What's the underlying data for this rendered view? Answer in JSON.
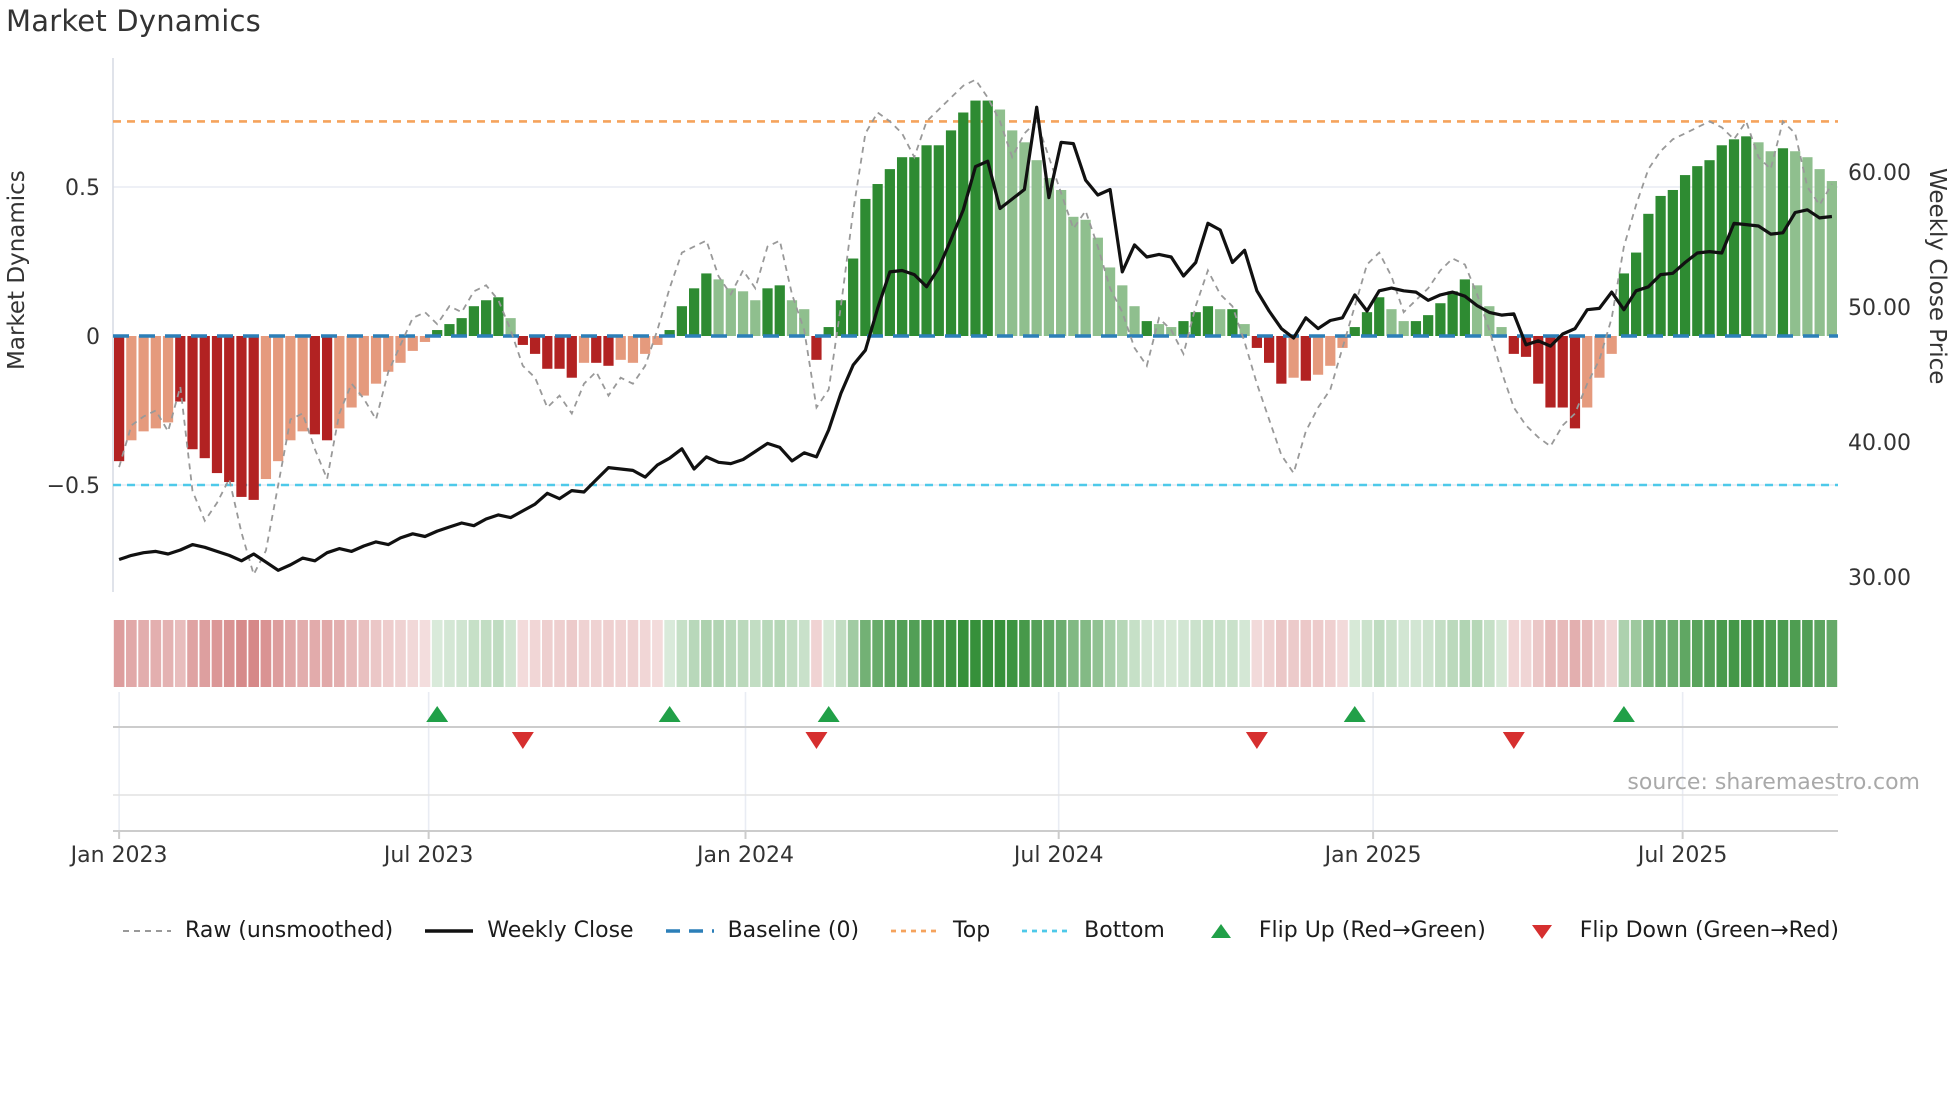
{
  "title": "Market Dynamics",
  "source_note": "source: sharemaestro.com",
  "colors": {
    "bar_dark_red": "#b22222",
    "bar_light_red": "#e59a7d",
    "bar_dark_green": "#2e8b32",
    "bar_light_green": "#8fbf8e",
    "baseline": "#2c7fb8",
    "top_line": "#f5a35c",
    "bottom_line": "#4ec9e9",
    "raw_line": "#999999",
    "price_line": "#111111",
    "flip_up": "#21a048",
    "flip_down": "#d62f2f",
    "grid": "#e9ecf3",
    "spine": "#d8dce4",
    "panel_line": "#cccccc",
    "tick_text": "#333333",
    "source_text": "#a9a9a9"
  },
  "axes": {
    "left": {
      "label": "Market Dynamics",
      "ticks": [
        {
          "v": 0.5,
          "label": "0.5"
        },
        {
          "v": 0,
          "label": "0"
        },
        {
          "v": -0.5,
          "label": "−0.5"
        }
      ]
    },
    "right": {
      "label": "Weekly Close Price",
      "ticks": [
        {
          "v": 60,
          "label": "60.00"
        },
        {
          "v": 50,
          "label": "50.00"
        },
        {
          "v": 40,
          "label": "40.00"
        },
        {
          "v": 30,
          "label": "30.00"
        }
      ]
    },
    "x": {
      "ticks": [
        {
          "i": 0,
          "label": "Jan 2023"
        },
        {
          "i": 25.3,
          "label": "Jul 2023"
        },
        {
          "i": 51.2,
          "label": "Jan 2024"
        },
        {
          "i": 76.8,
          "label": "Jul 2024"
        },
        {
          "i": 102.5,
          "label": "Jan 2025"
        },
        {
          "i": 127.8,
          "label": "Jul 2025"
        }
      ]
    }
  },
  "legend": [
    {
      "type": "dash-gray",
      "label": "Raw (unsmoothed)"
    },
    {
      "type": "solid-black",
      "label": "Weekly Close"
    },
    {
      "type": "dash-blue",
      "label": "Baseline (0)"
    },
    {
      "type": "dot-orange",
      "label": "Top"
    },
    {
      "type": "dot-cyan",
      "label": "Bottom"
    },
    {
      "type": "tri-up",
      "label": "Flip Up (Red→Green)"
    },
    {
      "type": "tri-down",
      "label": "Flip Down (Green→Red)"
    }
  ],
  "chart_data": {
    "type": "bar",
    "subtype": "composite-oscillator-with-price",
    "title": "Market Dynamics",
    "xlabel": "",
    "ylabel_left": "Market Dynamics",
    "ylabel_right": "Weekly Close Price",
    "x_range_labels": [
      "Jan 2023",
      "Jul 2023",
      "Jan 2024",
      "Jul 2024",
      "Jan 2025",
      "Jul 2025"
    ],
    "ylim_left": [
      -0.85,
      0.93
    ],
    "ylim_right_ticks": [
      30,
      40,
      50,
      60
    ],
    "reference_lines": {
      "baseline": 0,
      "top": 0.72,
      "bottom": -0.5
    },
    "legend_position": "bottom",
    "grid": "horizontal-faint",
    "bars_note": "weekly oscillator bars; shade d=saturated, l=muted; sign sets red/green",
    "bars": [
      [
        -0.42,
        "d"
      ],
      [
        -0.35,
        "l"
      ],
      [
        -0.32,
        "l"
      ],
      [
        -0.31,
        "l"
      ],
      [
        -0.29,
        "l"
      ],
      [
        -0.22,
        "d"
      ],
      [
        -0.38,
        "d"
      ],
      [
        -0.41,
        "d"
      ],
      [
        -0.46,
        "d"
      ],
      [
        -0.49,
        "d"
      ],
      [
        -0.54,
        "d"
      ],
      [
        -0.55,
        "d"
      ],
      [
        -0.48,
        "l"
      ],
      [
        -0.42,
        "l"
      ],
      [
        -0.35,
        "l"
      ],
      [
        -0.32,
        "l"
      ],
      [
        -0.33,
        "d"
      ],
      [
        -0.35,
        "d"
      ],
      [
        -0.31,
        "l"
      ],
      [
        -0.24,
        "l"
      ],
      [
        -0.2,
        "l"
      ],
      [
        -0.16,
        "l"
      ],
      [
        -0.12,
        "l"
      ],
      [
        -0.09,
        "l"
      ],
      [
        -0.05,
        "l"
      ],
      [
        -0.02,
        "l"
      ],
      [
        0.02,
        "d"
      ],
      [
        0.04,
        "d"
      ],
      [
        0.06,
        "d"
      ],
      [
        0.1,
        "d"
      ],
      [
        0.12,
        "d"
      ],
      [
        0.13,
        "d"
      ],
      [
        0.06,
        "l"
      ],
      [
        -0.03,
        "d"
      ],
      [
        -0.06,
        "d"
      ],
      [
        -0.11,
        "d"
      ],
      [
        -0.11,
        "d"
      ],
      [
        -0.14,
        "d"
      ],
      [
        -0.09,
        "l"
      ],
      [
        -0.09,
        "d"
      ],
      [
        -0.1,
        "d"
      ],
      [
        -0.08,
        "l"
      ],
      [
        -0.09,
        "l"
      ],
      [
        -0.06,
        "l"
      ],
      [
        -0.03,
        "l"
      ],
      [
        0.02,
        "d"
      ],
      [
        0.1,
        "d"
      ],
      [
        0.16,
        "d"
      ],
      [
        0.21,
        "d"
      ],
      [
        0.19,
        "l"
      ],
      [
        0.16,
        "l"
      ],
      [
        0.15,
        "l"
      ],
      [
        0.12,
        "l"
      ],
      [
        0.16,
        "d"
      ],
      [
        0.17,
        "d"
      ],
      [
        0.12,
        "l"
      ],
      [
        0.09,
        "l"
      ],
      [
        -0.08,
        "d"
      ],
      [
        0.03,
        "d"
      ],
      [
        0.12,
        "d"
      ],
      [
        0.26,
        "d"
      ],
      [
        0.46,
        "d"
      ],
      [
        0.51,
        "d"
      ],
      [
        0.56,
        "d"
      ],
      [
        0.6,
        "d"
      ],
      [
        0.6,
        "d"
      ],
      [
        0.64,
        "d"
      ],
      [
        0.64,
        "d"
      ],
      [
        0.69,
        "d"
      ],
      [
        0.75,
        "d"
      ],
      [
        0.79,
        "d"
      ],
      [
        0.79,
        "d"
      ],
      [
        0.76,
        "l"
      ],
      [
        0.69,
        "l"
      ],
      [
        0.65,
        "l"
      ],
      [
        0.59,
        "l"
      ],
      [
        0.53,
        "l"
      ],
      [
        0.49,
        "l"
      ],
      [
        0.4,
        "l"
      ],
      [
        0.39,
        "l"
      ],
      [
        0.33,
        "l"
      ],
      [
        0.23,
        "l"
      ],
      [
        0.17,
        "l"
      ],
      [
        0.1,
        "l"
      ],
      [
        0.05,
        "d"
      ],
      [
        0.04,
        "l"
      ],
      [
        0.03,
        "l"
      ],
      [
        0.05,
        "d"
      ],
      [
        0.08,
        "d"
      ],
      [
        0.1,
        "d"
      ],
      [
        0.09,
        "l"
      ],
      [
        0.09,
        "d"
      ],
      [
        0.04,
        "l"
      ],
      [
        -0.04,
        "d"
      ],
      [
        -0.09,
        "d"
      ],
      [
        -0.16,
        "d"
      ],
      [
        -0.14,
        "l"
      ],
      [
        -0.15,
        "d"
      ],
      [
        -0.13,
        "l"
      ],
      [
        -0.1,
        "l"
      ],
      [
        -0.04,
        "l"
      ],
      [
        0.03,
        "d"
      ],
      [
        0.08,
        "d"
      ],
      [
        0.13,
        "d"
      ],
      [
        0.09,
        "l"
      ],
      [
        0.05,
        "l"
      ],
      [
        0.05,
        "d"
      ],
      [
        0.07,
        "d"
      ],
      [
        0.11,
        "d"
      ],
      [
        0.15,
        "d"
      ],
      [
        0.19,
        "d"
      ],
      [
        0.17,
        "l"
      ],
      [
        0.1,
        "l"
      ],
      [
        0.03,
        "l"
      ],
      [
        -0.06,
        "d"
      ],
      [
        -0.07,
        "d"
      ],
      [
        -0.16,
        "d"
      ],
      [
        -0.24,
        "d"
      ],
      [
        -0.24,
        "d"
      ],
      [
        -0.31,
        "d"
      ],
      [
        -0.24,
        "l"
      ],
      [
        -0.14,
        "l"
      ],
      [
        -0.06,
        "l"
      ],
      [
        0.21,
        "d"
      ],
      [
        0.28,
        "d"
      ],
      [
        0.41,
        "d"
      ],
      [
        0.47,
        "d"
      ],
      [
        0.49,
        "d"
      ],
      [
        0.54,
        "d"
      ],
      [
        0.57,
        "d"
      ],
      [
        0.59,
        "d"
      ],
      [
        0.64,
        "d"
      ],
      [
        0.66,
        "d"
      ],
      [
        0.67,
        "d"
      ],
      [
        0.65,
        "l"
      ],
      [
        0.62,
        "l"
      ],
      [
        0.63,
        "d"
      ],
      [
        0.62,
        "l"
      ],
      [
        0.6,
        "l"
      ],
      [
        0.56,
        "l"
      ],
      [
        0.52,
        "l"
      ]
    ],
    "raw": [
      -0.44,
      -0.3,
      -0.27,
      -0.25,
      -0.32,
      -0.17,
      -0.52,
      -0.62,
      -0.56,
      -0.48,
      -0.66,
      -0.8,
      -0.72,
      -0.5,
      -0.28,
      -0.26,
      -0.38,
      -0.48,
      -0.26,
      -0.16,
      -0.21,
      -0.28,
      -0.12,
      -0.03,
      0.06,
      0.08,
      0.04,
      0.1,
      0.08,
      0.15,
      0.17,
      0.12,
      0.02,
      -0.1,
      -0.14,
      -0.24,
      -0.2,
      -0.26,
      -0.16,
      -0.12,
      -0.2,
      -0.14,
      -0.16,
      -0.1,
      0.02,
      0.16,
      0.28,
      0.3,
      0.32,
      0.2,
      0.14,
      0.22,
      0.16,
      0.3,
      0.32,
      0.14,
      0.02,
      -0.24,
      -0.18,
      0.1,
      0.42,
      0.68,
      0.75,
      0.72,
      0.68,
      0.6,
      0.72,
      0.76,
      0.8,
      0.84,
      0.86,
      0.8,
      0.72,
      0.6,
      0.68,
      0.72,
      0.6,
      0.48,
      0.36,
      0.42,
      0.3,
      0.16,
      0.08,
      -0.04,
      -0.1,
      0.06,
      0.02,
      -0.06,
      0.1,
      0.22,
      0.14,
      0.1,
      -0.02,
      -0.16,
      -0.28,
      -0.4,
      -0.46,
      -0.32,
      -0.24,
      -0.18,
      -0.04,
      0.1,
      0.24,
      0.28,
      0.2,
      0.08,
      0.12,
      0.16,
      0.22,
      0.26,
      0.24,
      0.14,
      0.02,
      -0.12,
      -0.24,
      -0.3,
      -0.34,
      -0.37,
      -0.3,
      -0.26,
      -0.16,
      -0.08,
      0.06,
      0.3,
      0.44,
      0.56,
      0.62,
      0.66,
      0.68,
      0.7,
      0.72,
      0.7,
      0.66,
      0.72,
      0.6,
      0.56,
      0.72,
      0.68,
      0.5,
      0.44,
      0.51
    ],
    "price": [
      31.3,
      31.6,
      31.8,
      31.9,
      31.7,
      32.0,
      32.4,
      32.2,
      31.9,
      31.6,
      31.2,
      31.7,
      31.1,
      30.5,
      30.9,
      31.4,
      31.2,
      31.8,
      32.1,
      31.9,
      32.3,
      32.6,
      32.4,
      32.9,
      33.2,
      33.0,
      33.4,
      33.7,
      34.0,
      33.8,
      34.3,
      34.6,
      34.4,
      34.9,
      35.4,
      36.2,
      35.8,
      36.4,
      36.3,
      37.2,
      38.1,
      38.0,
      37.9,
      37.4,
      38.3,
      38.8,
      39.5,
      38.0,
      38.9,
      38.5,
      38.4,
      38.7,
      39.3,
      39.9,
      39.6,
      38.6,
      39.2,
      38.9,
      40.9,
      43.6,
      45.7,
      46.8,
      49.9,
      52.6,
      52.7,
      52.4,
      51.5,
      52.9,
      55.0,
      57.2,
      60.4,
      60.8,
      57.3,
      58.0,
      58.7,
      64.8,
      58.1,
      62.2,
      62.1,
      59.4,
      58.3,
      58.7,
      52.6,
      54.6,
      53.7,
      53.9,
      53.7,
      52.3,
      53.3,
      56.2,
      55.7,
      53.3,
      54.2,
      51.2,
      49.7,
      48.4,
      47.7,
      49.2,
      48.4,
      49.0,
      49.2,
      50.9,
      49.7,
      51.2,
      51.4,
      51.2,
      51.1,
      50.5,
      50.9,
      51.1,
      50.8,
      50.1,
      49.6,
      49.4,
      49.5,
      47.2,
      47.5,
      47.1,
      48.0,
      48.4,
      49.8,
      49.9,
      51.1,
      49.8,
      51.2,
      51.5,
      52.4,
      52.5,
      53.3,
      54.0,
      54.1,
      54.0,
      56.2,
      56.1,
      56.0,
      55.4,
      55.5,
      57.0,
      57.2,
      56.6,
      56.7
    ],
    "heatmap_strip": "one cell per weekly bar, white-to-red/green intensity by bar value",
    "flip_markers_note": "up marker at first positive week after negative run; down marker at first negative week after positive run"
  }
}
